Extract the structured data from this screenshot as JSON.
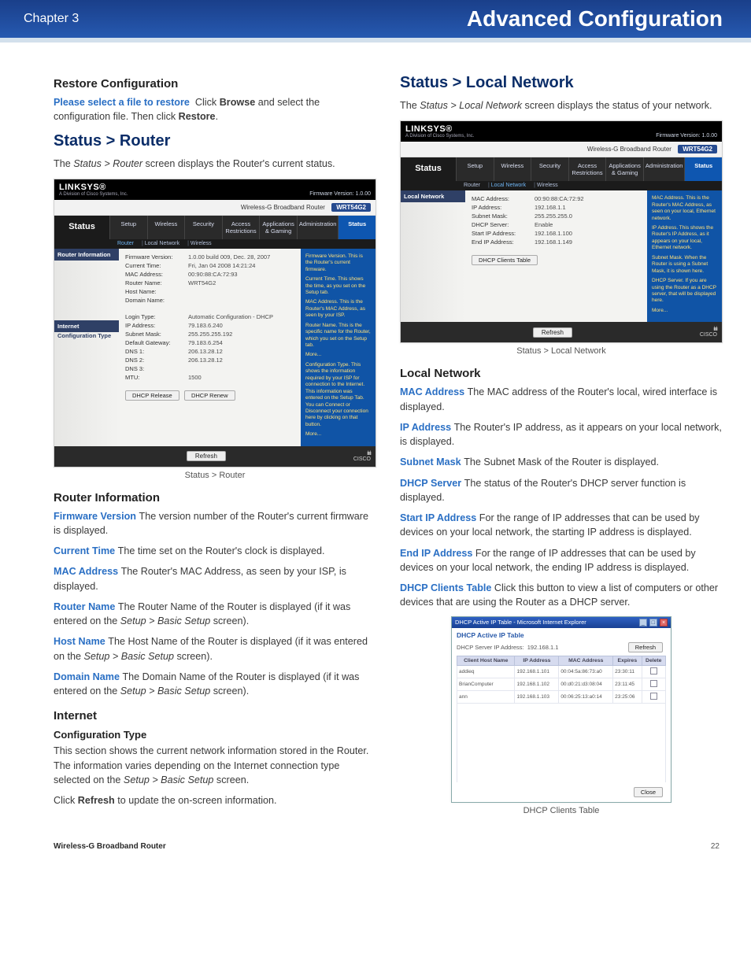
{
  "header": {
    "chapter": "Chapter 3",
    "title": "Advanced Configuration"
  },
  "footer": {
    "title": "Wireless-G Broadband Router",
    "page": "22"
  },
  "left": {
    "restore": {
      "heading": "Restore Configuration",
      "lead": "Please select a file to restore",
      "body_a": "Click",
      "b1": "Browse",
      "body_b": "and select the configuration file. Then click",
      "b2": "Restore",
      "period": "."
    },
    "statusRouter": {
      "heading": "Status > Router",
      "intro1": "The ",
      "introItal": "Status > Router",
      "intro2": " screen displays the Router's current status.",
      "figCaption": "Status > Router"
    },
    "routerInfo": {
      "heading": "Router Information",
      "fw_lead": "Firmware Version",
      "fw_body": "The version number of the Router's current firmware is displayed.",
      "ct_lead": "Current Time",
      "ct_body": "The time set on the Router's clock is displayed.",
      "mac_lead": "MAC Address",
      "mac_body": "The Router's MAC Address, as seen by your ISP, is displayed.",
      "rn_lead": "Router Name",
      "rn_body_a": "The Router Name of the Router is displayed (if it was entered on the ",
      "rn_ital": "Setup > Basic Setup",
      "rn_body_b": " screen).",
      "hn_lead": "Host Name",
      "hn_body_a": "The Host Name of the Router is displayed (if it was entered on the ",
      "hn_ital": "Setup > Basic Setup",
      "hn_body_b": " screen).",
      "dn_lead": "Domain Name",
      "dn_body_a": "The Domain Name of the Router is displayed (if it was entered on the ",
      "dn_ital": "Setup > Basic Setup",
      "dn_body_b": " screen)."
    },
    "internet": {
      "heading": "Internet",
      "sub": "Configuration Type",
      "body_a": "This section shows the current network information stored in the Router. The information varies depending on the Internet connection type selected on the ",
      "ital": "Setup > Basic Setup",
      "body_b": " screen.",
      "refresh_a": "Click ",
      "refresh_b": "Refresh",
      "refresh_c": " to update the on-screen information."
    },
    "lsRouter": {
      "brand": "LINKSYS®",
      "brand_sub": "A Division of Cisco Systems, Inc.",
      "fw": "Firmware Version: 1.0.00",
      "prodname": "Wireless-G Broadband Router",
      "model": "WRT54G2",
      "statusLabel": "Status",
      "tabs": [
        "Setup",
        "Wireless",
        "Security",
        "Access Restrictions",
        "Applications & Gaming",
        "Administration",
        "Status"
      ],
      "subtabs": [
        "Router",
        "Local Network",
        "Wireless"
      ],
      "panel1_title": "Router Information",
      "panel2_title": "Internet",
      "panel3_title": "Configuration Type",
      "rows1": [
        {
          "lbl": "Firmware Version:",
          "val": "1.0.00 build 009, Dec. 28, 2007"
        },
        {
          "lbl": "Current Time:",
          "val": "Fri, Jan 04 2008 14:21:24"
        },
        {
          "lbl": "MAC Address:",
          "val": "00:90:88:CA:72:93"
        },
        {
          "lbl": "Router Name:",
          "val": "WRT54G2"
        },
        {
          "lbl": "Host Name:",
          "val": ""
        },
        {
          "lbl": "Domain Name:",
          "val": ""
        }
      ],
      "rows2": [
        {
          "lbl": "Login Type:",
          "val": "Automatic Configuration - DHCP"
        },
        {
          "lbl": "IP Address:",
          "val": "79.183.6.240"
        },
        {
          "lbl": "Subnet Mask:",
          "val": "255.255.255.192"
        },
        {
          "lbl": "Default Gateway:",
          "val": "79.183.6.254"
        },
        {
          "lbl": "DNS 1:",
          "val": "206.13.28.12"
        },
        {
          "lbl": "DNS 2:",
          "val": "206.13.28.12"
        },
        {
          "lbl": "DNS 3:",
          "val": ""
        },
        {
          "lbl": "MTU:",
          "val": "1500"
        }
      ],
      "btns": [
        "DHCP Release",
        "DHCP Renew"
      ],
      "refreshBtn": "Refresh",
      "right": {
        "t1": "Firmware Version. This is the Router's current firmware.",
        "t2": "Current Time. This shows the time, as you set on the Setup tab.",
        "t3": "MAC Address. This is the Router's MAC Address, as seen by your ISP.",
        "t4": "Router Name. This is the specific name for the Router, which you set on the Setup tab.",
        "more1": "More...",
        "t5": "Configuration Type. This shows the information required by your ISP for connection to the Internet. This information was entered on the Setup Tab. You can Connect or Disconnect your connection here by clicking on that button.",
        "more2": "More..."
      },
      "cisco": "CISCO"
    }
  },
  "right": {
    "statusLocal": {
      "heading": "Status > Local Network",
      "intro1": "The ",
      "introItal": "Status > Local Network",
      "intro2": " screen displays the status of your network.",
      "figCaption": "Status > Local Network"
    },
    "lsLocal": {
      "brand": "LINKSYS®",
      "brand_sub": "A Division of Cisco Systems, Inc.",
      "fw": "Firmware Version: 1.0.00",
      "prodname": "Wireless-G Broadband Router",
      "model": "WRT54G2",
      "statusLabel": "Status",
      "tabs": [
        "Setup",
        "Wireless",
        "Security",
        "Access Restrictions",
        "Applications & Gaming",
        "Administration",
        "Status"
      ],
      "subtabs": [
        "Router",
        "Local Network",
        "Wireless"
      ],
      "panel1_title": "Local Network",
      "rows": [
        {
          "lbl": "MAC Address:",
          "val": "00:90:88:CA:72:92"
        },
        {
          "lbl": "IP Address:",
          "val": "192.168.1.1"
        },
        {
          "lbl": "Subnet Mask:",
          "val": "255.255.255.0"
        },
        {
          "lbl": "DHCP Server:",
          "val": "Enable"
        },
        {
          "lbl": "Start IP Address:",
          "val": "192.168.1.100"
        },
        {
          "lbl": "End IP Address:",
          "val": "192.168.1.149"
        }
      ],
      "clientsBtn": "DHCP Clients Table",
      "refreshBtn": "Refresh",
      "right": {
        "t1": "MAC Address. This is the Router's MAC Address, as seen on your local, Ethernet network.",
        "t2": "IP Address. This shows the Router's IP Address, as it appears on your local, Ethernet network.",
        "t3": "Subnet Mask. When the Router is using a Subnet Mask, it is shown here.",
        "t4": "DHCP Server. If you are using the Router as a DHCP server, that will be displayed here.",
        "more": "More..."
      },
      "cisco": "CISCO"
    },
    "localNetwork": {
      "heading": "Local Network",
      "mac_lead": "MAC Address",
      "mac_body": "The MAC address of the Router's local, wired interface is displayed.",
      "ip_lead": "IP Address",
      "ip_body": "The Router's IP address, as it appears on your local network, is displayed.",
      "sm_lead": "Subnet Mask",
      "sm_body": "The Subnet Mask of the Router is displayed.",
      "ds_lead": "DHCP Server",
      "ds_body": "The status of the Router's DHCP server function is displayed.",
      "sip_lead": "Start IP Address",
      "sip_body": "For the range of IP addresses that can be used by devices on your local network, the starting IP address is displayed.",
      "eip_lead": "End IP Address",
      "eip_body": "For the range of IP addresses that can be used by devices on your local network, the ending IP address is displayed.",
      "dct_lead": "DHCP Clients Table",
      "dct_body": "Click this button to view a list of computers or other devices that are using the Router as a DHCP server."
    },
    "dhcp": {
      "winTitle": "DHCP Active IP Table - Microsoft Internet Explorer",
      "activeTitle": "DHCP Active IP Table",
      "serverLine_a": "DHCP Server IP Address:",
      "serverLine_b": "192.168.1.1",
      "refreshBtn": "Refresh",
      "cols": [
        "Client Host Name",
        "IP Address",
        "MAC Address",
        "Expires",
        "Delete"
      ],
      "rows": [
        {
          "name": "addieq",
          "ip": "192.168.1.101",
          "mac": "00:04:5a:86:73:a0",
          "exp": "23:30:11"
        },
        {
          "name": "BrianComputer",
          "ip": "192.168.1.102",
          "mac": "00:d0:21:d3:08:04",
          "exp": "23:11:45"
        },
        {
          "name": "ann",
          "ip": "192.168.1.103",
          "mac": "00:06:25:13:a0:14",
          "exp": "23:25:06"
        }
      ],
      "closeBtn": "Close",
      "figCaption": "DHCP Clients Table"
    }
  }
}
